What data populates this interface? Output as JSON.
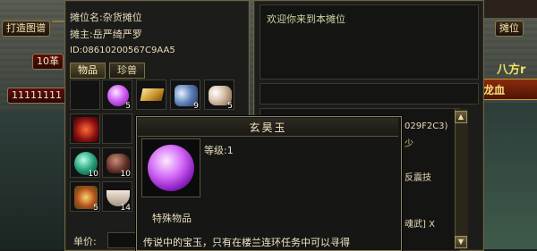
{
  "left_bar": {
    "btn_map": "打造图谱",
    "btn_10": "10革",
    "btn_ones": "11111111"
  },
  "right_bar": {
    "stall": "摊位",
    "banner": "八方r",
    "banner2": "龙血"
  },
  "stall": {
    "name_label": "摊位名:",
    "name_value": "杂货摊位",
    "owner_label": "摊主:",
    "owner_value": "岳严绮严罗",
    "id_label": "ID:",
    "id_value": "08610200567C9AA5",
    "tabs": [
      {
        "label": "物品"
      },
      {
        "label": "珍兽"
      }
    ],
    "price_label": "单价:"
  },
  "inventory": [
    {
      "icon": "empty-slot",
      "count": ""
    },
    {
      "icon": "purple-orb-icon",
      "count": "5"
    },
    {
      "icon": "gold-bar-icon",
      "count": ""
    },
    {
      "icon": "gem-cluster-icon",
      "count": "9"
    },
    {
      "icon": "pearls-icon",
      "count": "5"
    },
    {
      "icon": "red-dragon-icon",
      "count": ""
    },
    {
      "icon": "empty-slot",
      "count": ""
    },
    {
      "icon": "green-orb-icon",
      "count": "10"
    },
    {
      "icon": "brown-stone-icon",
      "count": "10"
    },
    {
      "icon": "herb-icon",
      "count": "5"
    },
    {
      "icon": "bowl-icon",
      "count": "14"
    }
  ],
  "chat": {
    "welcome": "欢迎你来到本摊位",
    "line_hex": "029F2C3)",
    "line_less": "少",
    "line_skill": "反震技",
    "line_soul": "魂武] X"
  },
  "tooltip": {
    "title": "玄昊玉",
    "level_label": "等级:",
    "level_value": "1",
    "category": "特殊物品",
    "description": "传说中的宝玉，只有在楼兰连环任务中可以寻得"
  },
  "colors": {
    "panel_border": "#6b6446",
    "text_gold": "#e8dcb8",
    "welcome_green": "#c8d89a",
    "orb_purple": "#c44cf0"
  }
}
